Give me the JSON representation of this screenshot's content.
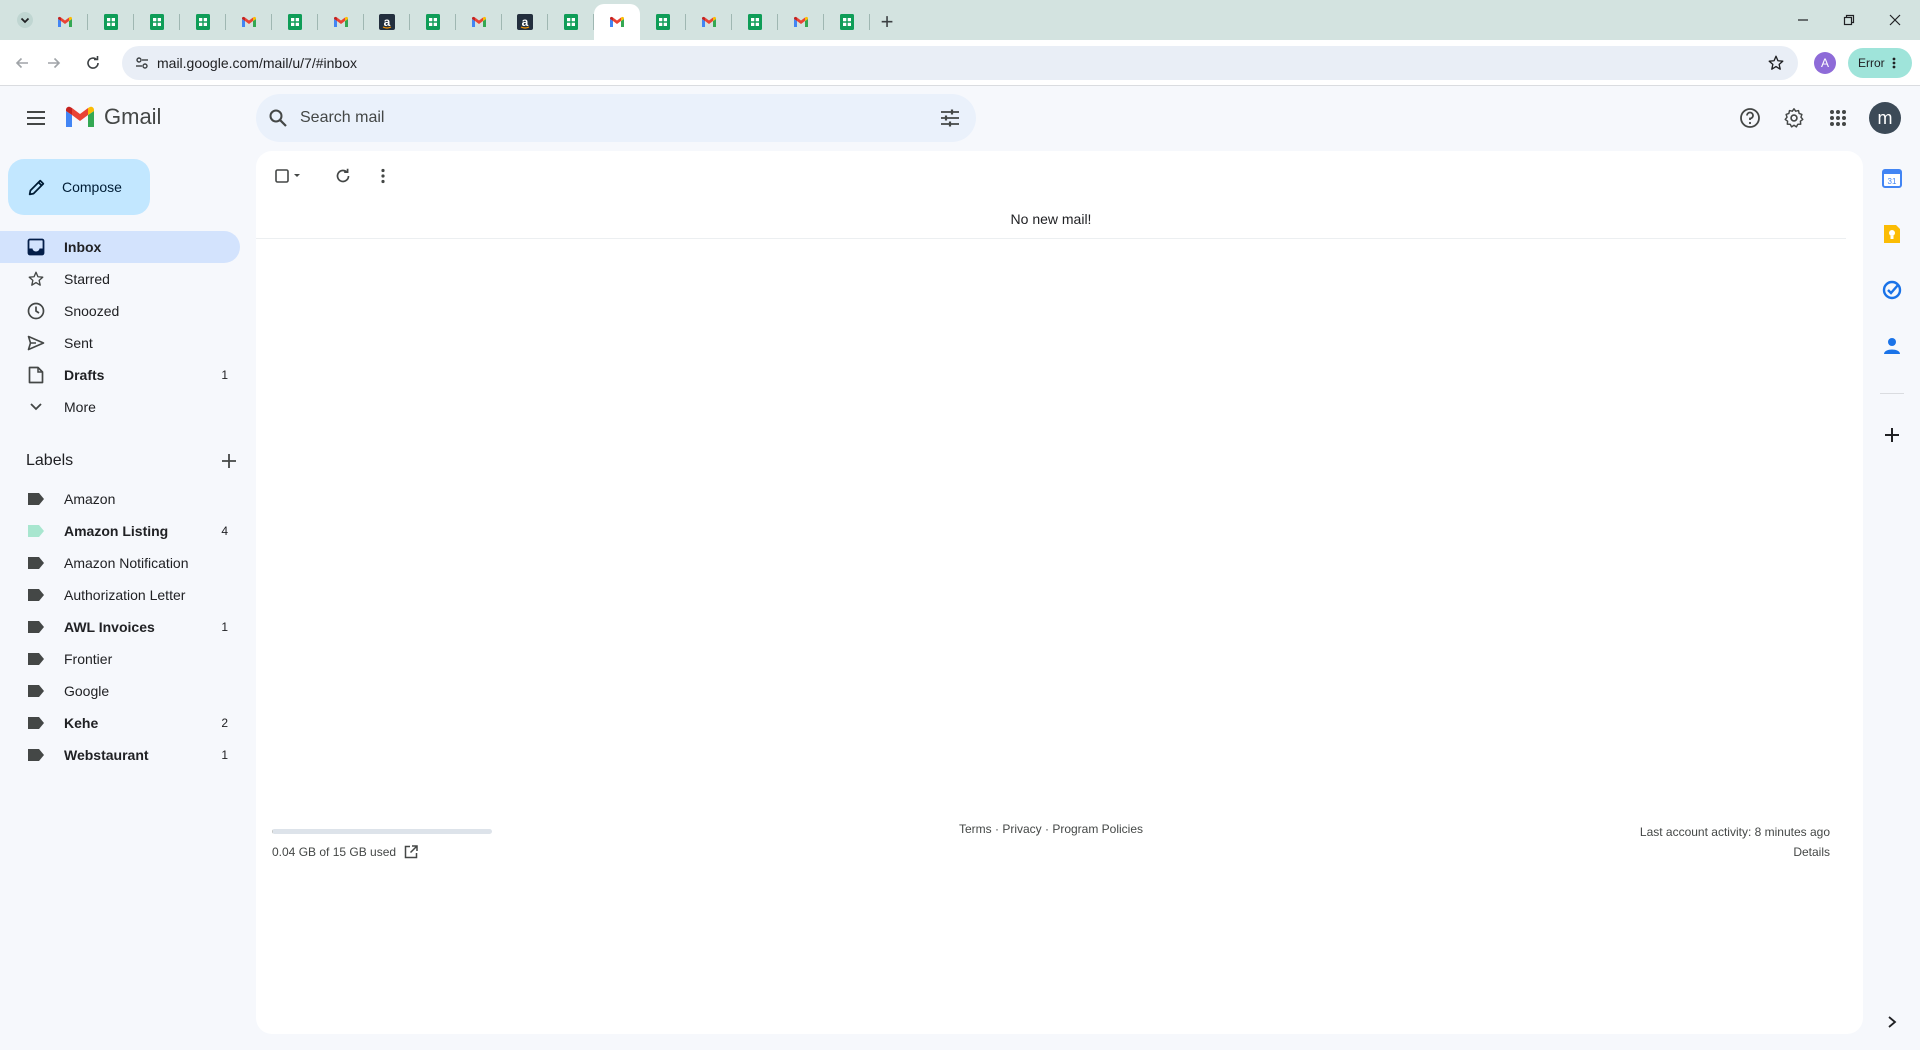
{
  "browser": {
    "tabs": [
      {
        "icon": "gmail-icon",
        "active": false
      },
      {
        "icon": "sheets-icon",
        "active": false
      },
      {
        "icon": "sheets-icon",
        "active": false
      },
      {
        "icon": "sheets-icon",
        "active": false
      },
      {
        "icon": "gmail-icon",
        "active": false
      },
      {
        "icon": "sheets-icon",
        "active": false
      },
      {
        "icon": "gmail-icon",
        "active": false
      },
      {
        "icon": "amazon-icon",
        "active": false
      },
      {
        "icon": "sheets-icon",
        "active": false
      },
      {
        "icon": "gmail-icon",
        "active": false
      },
      {
        "icon": "amazon-icon",
        "active": false
      },
      {
        "icon": "sheets-icon",
        "active": false
      },
      {
        "icon": "gmail-icon",
        "active": true
      },
      {
        "icon": "sheets-icon",
        "active": false
      },
      {
        "icon": "gmail-icon",
        "active": false
      },
      {
        "icon": "sheets-icon",
        "active": false
      },
      {
        "icon": "gmail-icon",
        "active": false
      },
      {
        "icon": "sheets-icon",
        "active": false
      }
    ],
    "new_tab_label": "+",
    "url": "mail.google.com/mail/u/7/#inbox",
    "profile_initial": "A",
    "error_label": "Error"
  },
  "gmail": {
    "logo_text": "Gmail",
    "search_placeholder": "Search mail",
    "account_initial": "m",
    "compose_label": "Compose",
    "nav": [
      {
        "key": "inbox",
        "label": "Inbox",
        "count": "",
        "icon": "inbox-icon",
        "active": true,
        "bold": true
      },
      {
        "key": "starred",
        "label": "Starred",
        "count": "",
        "icon": "star-icon",
        "active": false,
        "bold": false
      },
      {
        "key": "snoozed",
        "label": "Snoozed",
        "count": "",
        "icon": "clock-icon",
        "active": false,
        "bold": false
      },
      {
        "key": "sent",
        "label": "Sent",
        "count": "",
        "icon": "send-icon",
        "active": false,
        "bold": false
      },
      {
        "key": "drafts",
        "label": "Drafts",
        "count": "1",
        "icon": "draft-icon",
        "active": false,
        "bold": true
      },
      {
        "key": "more",
        "label": "More",
        "count": "",
        "icon": "chevron-down-icon",
        "active": false,
        "bold": false
      }
    ],
    "labels_title": "Labels",
    "labels": [
      {
        "label": "Amazon",
        "count": "",
        "bold": false,
        "color": "#444746"
      },
      {
        "label": "Amazon Listing",
        "count": "4",
        "bold": true,
        "color": "#a8e6cf"
      },
      {
        "label": "Amazon Notification",
        "count": "",
        "bold": false,
        "color": "#444746"
      },
      {
        "label": "Authorization Letter",
        "count": "",
        "bold": false,
        "color": "#444746"
      },
      {
        "label": "AWL Invoices",
        "count": "1",
        "bold": true,
        "color": "#444746"
      },
      {
        "label": "Frontier",
        "count": "",
        "bold": false,
        "color": "#444746"
      },
      {
        "label": "Google",
        "count": "",
        "bold": false,
        "color": "#444746"
      },
      {
        "label": "Kehe",
        "count": "2",
        "bold": true,
        "color": "#444746"
      },
      {
        "label": "Webstaurant",
        "count": "1",
        "bold": true,
        "color": "#444746"
      }
    ],
    "main": {
      "empty_message": "No new mail!",
      "storage_text": "0.04 GB of 15 GB used",
      "storage_fraction": 0.003,
      "footer_terms": "Terms",
      "footer_privacy": "Privacy",
      "footer_policies": "Program Policies",
      "footer_sep": " · ",
      "last_activity": "Last account activity: 8 minutes ago",
      "details": "Details"
    }
  },
  "colors": {
    "compose_bg": "#c2e7ff",
    "active_nav_bg": "#d3e3fd",
    "search_bg": "#eaf1fb",
    "tabbar_bg": "#d3e3e0",
    "error_chip": "#9fe4da"
  }
}
